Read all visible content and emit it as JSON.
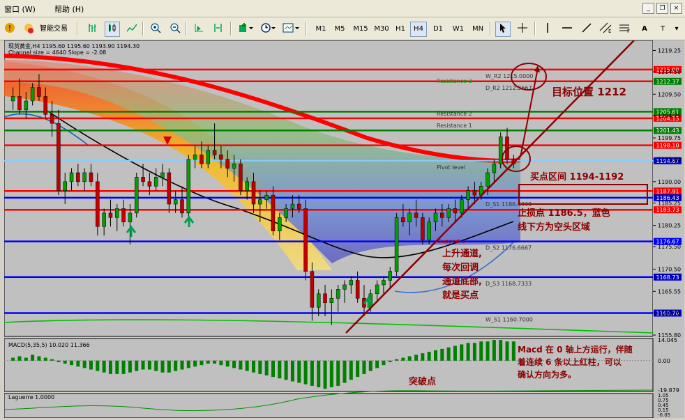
{
  "menu": {
    "window": "窗口 (W)",
    "help": "帮助 (H)"
  },
  "window_controls": {
    "min": "_",
    "restore": "❐",
    "close": "×"
  },
  "toolbar": {
    "autotrade": "智能交易",
    "timeframes": [
      "M1",
      "M5",
      "M15",
      "M30",
      "H1",
      "H4",
      "D1",
      "W1",
      "MN"
    ],
    "active_timeframe": "H4",
    "right_tools": [
      "A",
      "T"
    ]
  },
  "colors": {
    "resistance": "#ff0000",
    "support": "#0000ff",
    "price_tag_red": "#ff0000",
    "price_tag_green": "#007f00",
    "price_tag_blue": "#0000c0",
    "annotation": "#8b0000",
    "trend": "#8b0000"
  },
  "chart_data": [
    {
      "type": "candlestick",
      "title": "现货黄金,H4 1195.60 1195.60 1193.90 1194.30",
      "subtitle": "Channel size = 4640 Slope = -2.08",
      "ylim": [
        1155.5,
        1221.5
      ],
      "y_ticks": [
        1219.25,
        1214.5,
        1209.5,
        1204.75,
        1199.75,
        1195.0,
        1190.0,
        1185.25,
        1180.25,
        1175.5,
        1170.5,
        1165.55,
        1160.75,
        1155.8
      ],
      "price_lines": [
        {
          "value": 1215.0,
          "label": "W_R2 1215.0000",
          "color": "#ff0000",
          "tag": "1215.00"
        },
        {
          "value": 1212.37,
          "label": "D_R2 1212.3667",
          "color": "#ff0000",
          "tag": "1212.37",
          "tag_color": "#007f00"
        },
        {
          "value": 1205.61,
          "label": "",
          "color": "#007f00",
          "tag": "1205.61",
          "tag_color": "#007f00"
        },
        {
          "value": 1204.13,
          "label": "Resistance 2",
          "color": "#ff0000",
          "tag": "1204.13"
        },
        {
          "value": 1201.43,
          "label": "Resistance 1",
          "color": "#007f00",
          "tag": "1201.43",
          "tag_color": "#007f00"
        },
        {
          "value": 1198.1,
          "label": "",
          "color": "#ff0000",
          "tag": "1198.10"
        },
        {
          "value": 1194.67,
          "label": "Pivot level",
          "color": "#87cefa",
          "tag": "1194.67",
          "tag_color": "#0000c0"
        },
        {
          "value": 1187.91,
          "label": "",
          "color": "#ff0000",
          "tag": "1187.91"
        },
        {
          "value": 1186.43,
          "label": "D_S1 1186.4333",
          "color": "#0000ff",
          "tag": "1186.43",
          "tag_color": "#0000c0"
        },
        {
          "value": 1183.73,
          "label": "",
          "color": "#ff0000",
          "tag": "1183.73"
        },
        {
          "value": 1176.67,
          "label": "D_S2 1176.6667",
          "color": "#0000ff",
          "tag": "1176.67"
        },
        {
          "value": 1168.73,
          "label": "D_S3 1168.7333",
          "color": "#0000ff",
          "tag": "1168.73",
          "tag_color": "#0000c0"
        },
        {
          "value": 1160.7,
          "label": "W_S1 1160.7000",
          "color": "#0000ff",
          "tag": "1160.70",
          "tag_color": "#0000c0"
        }
      ],
      "extra_labels": [
        "Resistance 3",
        "Support 1"
      ],
      "candles": [
        [
          1208,
          1211,
          1206,
          1209
        ],
        [
          1209,
          1213,
          1205,
          1206
        ],
        [
          1206,
          1210,
          1204,
          1208
        ],
        [
          1208,
          1212,
          1207,
          1211
        ],
        [
          1211,
          1214,
          1208,
          1209
        ],
        [
          1209,
          1211,
          1204,
          1205
        ],
        [
          1205,
          1208,
          1200,
          1203
        ],
        [
          1203,
          1206,
          1187,
          1188
        ],
        [
          1188,
          1192,
          1185,
          1190
        ],
        [
          1190,
          1193,
          1188,
          1192
        ],
        [
          1192,
          1194,
          1189,
          1190
        ],
        [
          1190,
          1193,
          1188,
          1192
        ],
        [
          1192,
          1194,
          1189,
          1190
        ],
        [
          1190,
          1192,
          1178,
          1180
        ],
        [
          1180,
          1184,
          1178,
          1183
        ],
        [
          1183,
          1186,
          1180,
          1182
        ],
        [
          1182,
          1185,
          1179,
          1184
        ],
        [
          1184,
          1186,
          1180,
          1181
        ],
        [
          1181,
          1185,
          1176,
          1183
        ],
        [
          1183,
          1192,
          1182,
          1191
        ],
        [
          1191,
          1194,
          1189,
          1190
        ],
        [
          1190,
          1192,
          1187,
          1189
        ],
        [
          1189,
          1193,
          1188,
          1191
        ],
        [
          1191,
          1194,
          1189,
          1192
        ],
        [
          1192,
          1193,
          1183,
          1185
        ],
        [
          1185,
          1188,
          1183,
          1186
        ],
        [
          1186,
          1189,
          1182,
          1183
        ],
        [
          1183,
          1196,
          1182,
          1195
        ],
        [
          1195,
          1198,
          1193,
          1196
        ],
        [
          1196,
          1199,
          1193,
          1194
        ],
        [
          1194,
          1198,
          1193,
          1197
        ],
        [
          1197,
          1203,
          1195,
          1196
        ],
        [
          1196,
          1198,
          1193,
          1195
        ],
        [
          1195,
          1197,
          1191,
          1193
        ],
        [
          1193,
          1196,
          1190,
          1194
        ],
        [
          1194,
          1195,
          1187,
          1188
        ],
        [
          1188,
          1191,
          1186,
          1190
        ],
        [
          1190,
          1192,
          1183,
          1185
        ],
        [
          1185,
          1188,
          1181,
          1186
        ],
        [
          1186,
          1188,
          1184,
          1187
        ],
        [
          1187,
          1189,
          1178,
          1179
        ],
        [
          1179,
          1183,
          1177,
          1182
        ],
        [
          1182,
          1185,
          1181,
          1184
        ],
        [
          1184,
          1187,
          1182,
          1185
        ],
        [
          1185,
          1187,
          1183,
          1184
        ],
        [
          1184,
          1186,
          1168,
          1170
        ],
        [
          1170,
          1172,
          1159,
          1162
        ],
        [
          1162,
          1166,
          1160,
          1165
        ],
        [
          1165,
          1167,
          1160,
          1163
        ],
        [
          1163,
          1166,
          1158,
          1164
        ],
        [
          1164,
          1167,
          1161,
          1166
        ],
        [
          1166,
          1168,
          1163,
          1167
        ],
        [
          1167,
          1169,
          1165,
          1168
        ],
        [
          1168,
          1170,
          1163,
          1164
        ],
        [
          1164,
          1167,
          1160,
          1162
        ],
        [
          1162,
          1166,
          1161,
          1165
        ],
        [
          1165,
          1168,
          1163,
          1167
        ],
        [
          1167,
          1169,
          1165,
          1168
        ],
        [
          1168,
          1171,
          1166,
          1170
        ],
        [
          1170,
          1183,
          1169,
          1182
        ],
        [
          1182,
          1185,
          1180,
          1181
        ],
        [
          1181,
          1184,
          1178,
          1183
        ],
        [
          1183,
          1186,
          1180,
          1182
        ],
        [
          1182,
          1183,
          1176,
          1177
        ],
        [
          1177,
          1182,
          1176,
          1181
        ],
        [
          1181,
          1184,
          1179,
          1183
        ],
        [
          1183,
          1185,
          1180,
          1182
        ],
        [
          1182,
          1185,
          1181,
          1184
        ],
        [
          1184,
          1186,
          1181,
          1183
        ],
        [
          1183,
          1187,
          1182,
          1186
        ],
        [
          1186,
          1189,
          1184,
          1188
        ],
        [
          1188,
          1190,
          1185,
          1187
        ],
        [
          1187,
          1190,
          1186,
          1189
        ],
        [
          1189,
          1193,
          1187,
          1192
        ],
        [
          1192,
          1195,
          1190,
          1194
        ],
        [
          1194,
          1201,
          1193,
          1200
        ],
        [
          1200,
          1202,
          1194,
          1195
        ],
        [
          1195,
          1196,
          1193,
          1194
        ]
      ]
    },
    {
      "type": "bar",
      "title": "MACD(5,35,5) 10.020 11.366",
      "ylim": [
        -19.879,
        14.045
      ],
      "y_ticks": [
        14.045,
        0.0,
        -19.879
      ],
      "values": [
        2,
        3,
        2,
        4,
        3,
        2,
        1,
        -1,
        -2,
        -3,
        -4,
        -5,
        -6,
        -7,
        -8,
        -9,
        -9,
        -9,
        -8,
        -7,
        -6,
        -6,
        -7,
        -8,
        -8,
        -7,
        -6,
        -5,
        -4,
        -3,
        -2,
        -2,
        -3,
        -4,
        -5,
        -6,
        -7,
        -8,
        -9,
        -10,
        -11,
        -12,
        -13,
        -14,
        -15,
        -16,
        -17,
        -18,
        -19,
        -18,
        -17,
        -15,
        -13,
        -11,
        -9,
        -7,
        -5,
        -3,
        -1,
        1,
        2,
        3,
        4,
        5,
        6,
        7,
        8,
        9,
        10,
        11,
        12,
        12,
        13,
        13,
        14,
        14,
        13,
        13
      ]
    },
    {
      "type": "line",
      "title": "Laguerre 1.0000",
      "ylim": [
        0,
        1
      ],
      "y_ticks": [
        1.05,
        0.75,
        0.45,
        0.15,
        -0.05
      ]
    }
  ],
  "annotations": {
    "target": "目标位置 1212",
    "buy_zone": "买点区间 1194-1192",
    "stop_line1": "止损点 1186.5，蓝色",
    "stop_line2": "线下方为空头区域",
    "channel_line1": "上升通道,",
    "channel_line2": "每次回调",
    "channel_line3": "通道底部,",
    "channel_line4": "就是买点",
    "macd_line1": "Macd 在 0 轴上方运行，伴随",
    "macd_line2": "着连续 6 条以上红柱，可以",
    "macd_line3": "确认方向为多。",
    "breakout": "突破点"
  }
}
